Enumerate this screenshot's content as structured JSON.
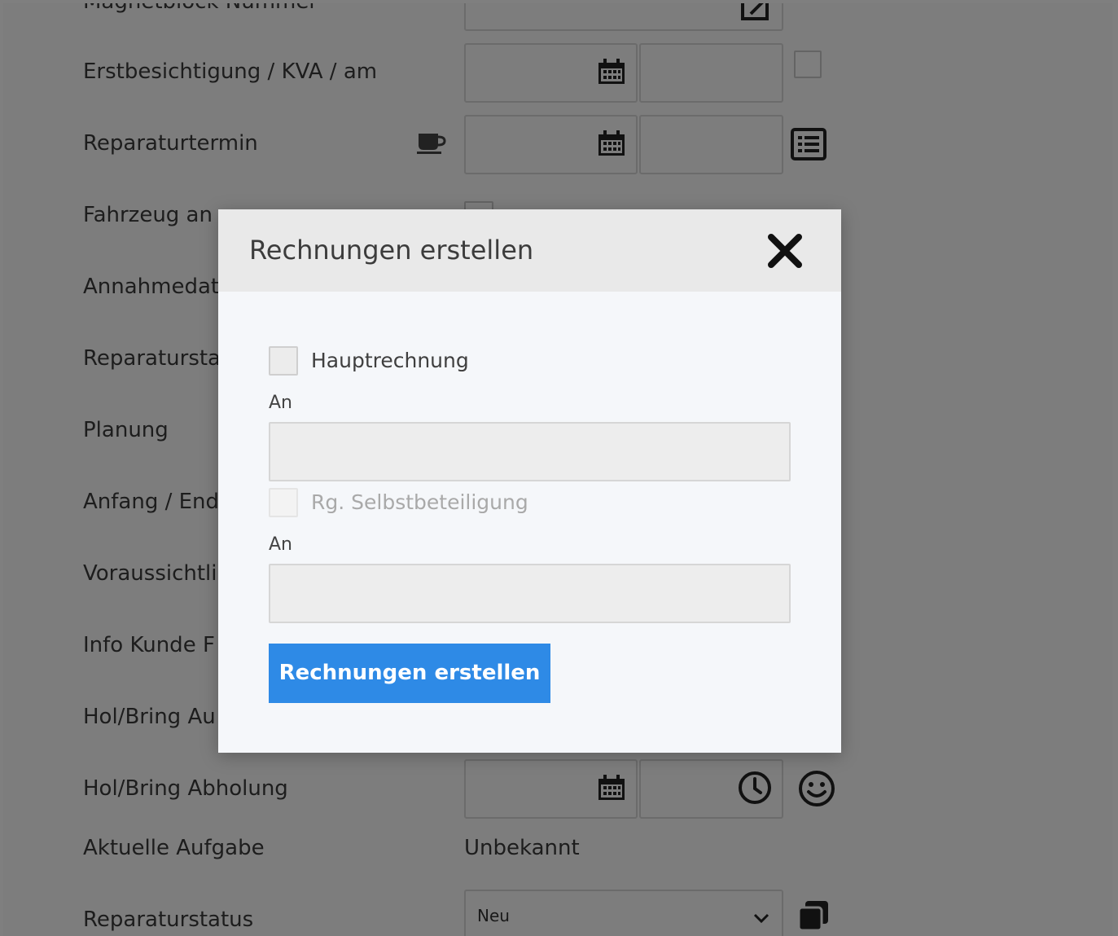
{
  "form": {
    "rows": {
      "magnetblock": "Magnetblock Nummer",
      "erstbesichtigung": "Erstbesichtigung / KVA / am",
      "reparaturtermin": "Reparaturtermin",
      "fahrzeug": "Fahrzeug an",
      "annahme": "Annahmedat",
      "reparaturstart": "Reparatursta",
      "planung": "Planung",
      "anfang": "Anfang / End",
      "voraussichtlich": "Voraussichtli",
      "info_kunde": "Info Kunde F",
      "holbring_auslieferung": "Hol/Bring Au",
      "holbring_abholung": "Hol/Bring Abholung",
      "aktuelle_aufgabe": "Aktuelle Aufgabe",
      "reparaturstatus": "Reparaturstatus"
    },
    "aktuelle_aufgabe_value": "Unbekannt",
    "reparaturstatus_value": "Neu"
  },
  "modal": {
    "title": "Rechnungen erstellen",
    "hauptrechnung_label": "Hauptrechnung",
    "an_label_1": "An",
    "selbstbeteiligung_label": "Rg. Selbstbeteiligung",
    "an_label_2": "An",
    "submit_label": "Rechnungen erstellen"
  },
  "colors": {
    "accent": "#2e8ae6",
    "overlay": "rgba(0,0,0,0.5)"
  }
}
